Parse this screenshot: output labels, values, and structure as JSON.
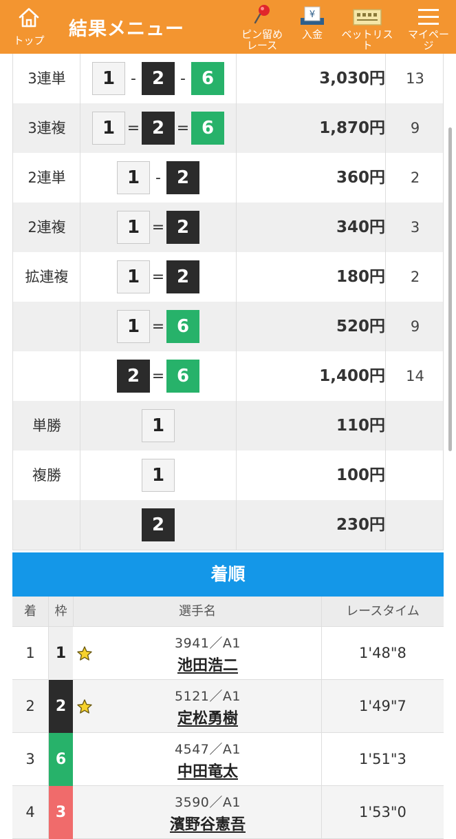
{
  "header": {
    "home_label": "トップ",
    "title": "結果メニュー",
    "nav": [
      {
        "label": "ピン留め\nレース",
        "icon": "pushpin-icon"
      },
      {
        "label": "入金",
        "icon": "deposit-icon"
      },
      {
        "label": "ベットリスト",
        "icon": "ticket-icon"
      },
      {
        "label": "マイページ",
        "icon": "menu-icon"
      }
    ],
    "nav_line1": "ピン留め",
    "nav_line2": "レース"
  },
  "payouts": [
    {
      "type": "3連単",
      "combo": [
        "1",
        "2",
        "6"
      ],
      "sep": "-",
      "amount": "3,030円",
      "popularity": "13"
    },
    {
      "type": "3連複",
      "combo": [
        "1",
        "2",
        "6"
      ],
      "sep": "=",
      "amount": "1,870円",
      "popularity": "9"
    },
    {
      "type": "2連単",
      "combo": [
        "1",
        "2"
      ],
      "sep": "-",
      "amount": "360円",
      "popularity": "2"
    },
    {
      "type": "2連複",
      "combo": [
        "1",
        "2"
      ],
      "sep": "=",
      "amount": "340円",
      "popularity": "3"
    },
    {
      "type": "拡連複",
      "combo": [
        "1",
        "2"
      ],
      "sep": "=",
      "amount": "180円",
      "popularity": "2"
    },
    {
      "type": "",
      "combo": [
        "1",
        "6"
      ],
      "sep": "=",
      "amount": "520円",
      "popularity": "9"
    },
    {
      "type": "",
      "combo": [
        "2",
        "6"
      ],
      "sep": "=",
      "amount": "1,400円",
      "popularity": "14"
    },
    {
      "type": "単勝",
      "combo": [
        "1"
      ],
      "sep": "",
      "amount": "110円",
      "popularity": ""
    },
    {
      "type": "複勝",
      "combo": [
        "1"
      ],
      "sep": "",
      "amount": "100円",
      "popularity": ""
    },
    {
      "type": "",
      "combo": [
        "2"
      ],
      "sep": "",
      "amount": "230円",
      "popularity": ""
    }
  ],
  "results": {
    "title": "着順",
    "headers": {
      "rank": "着",
      "waku": "枠",
      "name": "選手名",
      "time": "レースタイム"
    },
    "rows": [
      {
        "rank": "1",
        "waku": "1",
        "star": true,
        "reg": "3941／A1",
        "name": "池田浩二",
        "time": "1'48\"8"
      },
      {
        "rank": "2",
        "waku": "2",
        "star": true,
        "reg": "5121／A1",
        "name": "定松勇樹",
        "time": "1'49\"7"
      },
      {
        "rank": "3",
        "waku": "6",
        "star": false,
        "reg": "4547／A1",
        "name": "中田竜太",
        "time": "1'51\"3"
      },
      {
        "rank": "4",
        "waku": "3",
        "star": false,
        "reg": "3590／A1",
        "name": "濱野谷憲吾",
        "time": "1'53\"0"
      }
    ]
  },
  "colors": {
    "header": "#f39530",
    "results_title": "#1497e8",
    "waku1": "#f4f4f4",
    "waku2": "#2b2b2b",
    "waku3": "#f06b6b",
    "waku6": "#27b26a"
  }
}
